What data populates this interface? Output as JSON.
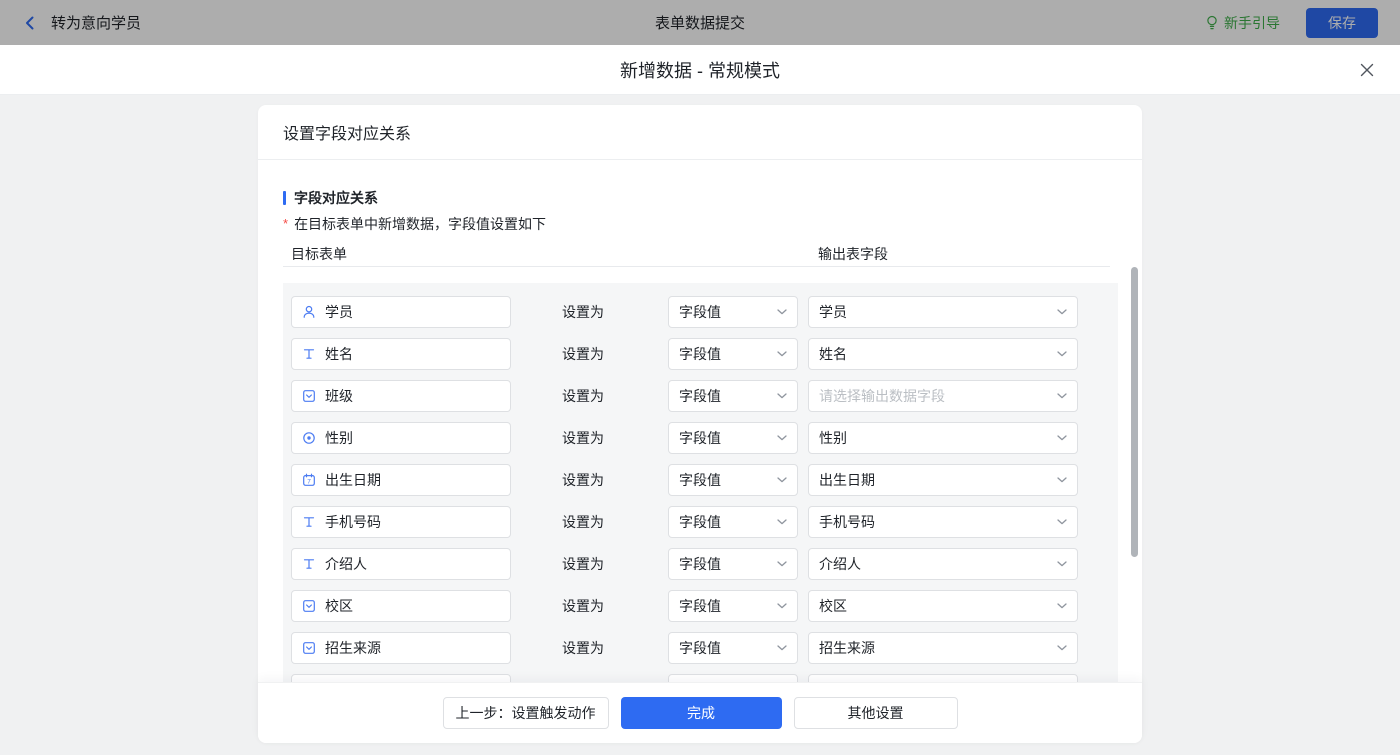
{
  "topbar": {
    "back_label": "转为意向学员",
    "title": "表单数据提交",
    "guide_label": "新手引导",
    "save_label": "保存"
  },
  "modal": {
    "title": "新增数据 - 常规模式",
    "card": {
      "header_title": "设置字段对应关系",
      "section_title": "字段对应关系",
      "required_mark": "*",
      "note": "在目标表单中新增数据，字段值设置如下",
      "columns": {
        "left": "目标表单",
        "right": "输出表字段"
      },
      "set_as_label": "设置为",
      "value_dropdown_label": "字段值",
      "output_placeholder": "请选择输出数据字段",
      "rows": [
        {
          "icon": "user-icon",
          "field": "学员",
          "output": "学员"
        },
        {
          "icon": "text-icon",
          "field": "姓名",
          "output": "姓名"
        },
        {
          "icon": "select-icon",
          "field": "班级",
          "output": "",
          "uses_placeholder": true
        },
        {
          "icon": "radio-icon",
          "field": "性别",
          "output": "性别"
        },
        {
          "icon": "calendar-icon",
          "field": "出生日期",
          "output": "出生日期"
        },
        {
          "icon": "text-icon",
          "field": "手机号码",
          "output": "手机号码"
        },
        {
          "icon": "text-icon",
          "field": "介绍人",
          "output": "介绍人"
        },
        {
          "icon": "select-icon",
          "field": "校区",
          "output": "校区"
        },
        {
          "icon": "select-icon",
          "field": "招生来源",
          "output": "招生来源"
        },
        {
          "icon": "",
          "field": "",
          "output": "",
          "partial": true
        }
      ],
      "footer": {
        "prev_label": "上一步：设置触发动作",
        "finish_label": "完成",
        "other_label": "其他设置"
      }
    }
  },
  "colors": {
    "accent": "#2e6bf2",
    "icon_blue": "#4c7cf2",
    "guide_green": "#3fae4a",
    "required_red": "#f54a45"
  }
}
